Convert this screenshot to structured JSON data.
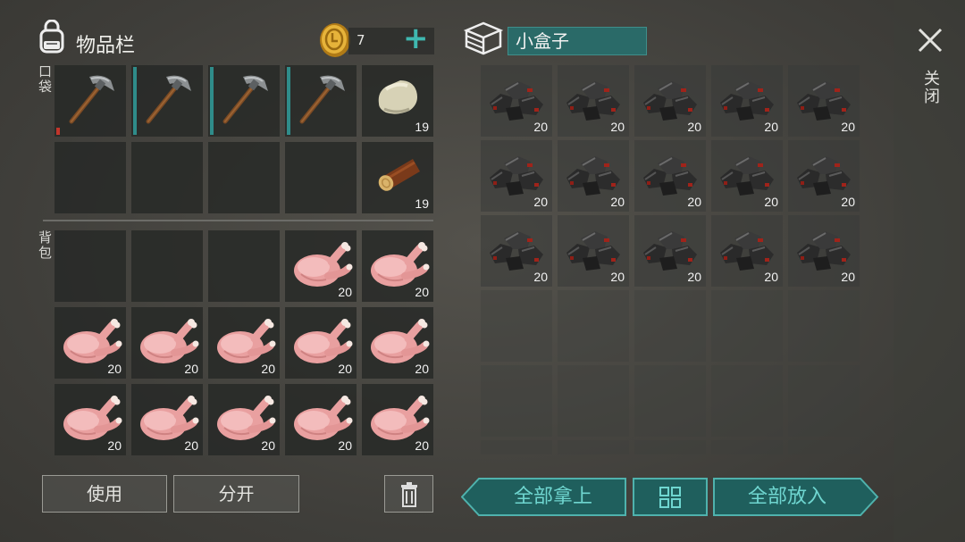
{
  "inventory": {
    "title": "物品栏",
    "pocket_label": "口袋",
    "backpack_label": "背包",
    "coins": "7",
    "add_symbol": "+",
    "pocket_slots": [
      {
        "item": "pickaxe",
        "count": "",
        "durability": "low"
      },
      {
        "item": "pickaxe",
        "count": "",
        "durability": "full"
      },
      {
        "item": "pickaxe",
        "count": "",
        "durability": "full"
      },
      {
        "item": "pickaxe",
        "count": "",
        "durability": "full"
      },
      {
        "item": "stone",
        "count": "19"
      },
      {
        "item": "",
        "count": ""
      },
      {
        "item": "",
        "count": ""
      },
      {
        "item": "",
        "count": ""
      },
      {
        "item": "",
        "count": ""
      },
      {
        "item": "log",
        "count": "19"
      }
    ],
    "backpack_slots": [
      {
        "item": "",
        "count": ""
      },
      {
        "item": "",
        "count": ""
      },
      {
        "item": "",
        "count": ""
      },
      {
        "item": "raw-chicken",
        "count": "20"
      },
      {
        "item": "raw-chicken",
        "count": "20"
      },
      {
        "item": "raw-chicken",
        "count": "20"
      },
      {
        "item": "raw-chicken",
        "count": "20"
      },
      {
        "item": "raw-chicken",
        "count": "20"
      },
      {
        "item": "raw-chicken",
        "count": "20"
      },
      {
        "item": "raw-chicken",
        "count": "20"
      },
      {
        "item": "raw-chicken",
        "count": "20"
      },
      {
        "item": "raw-chicken",
        "count": "20"
      },
      {
        "item": "raw-chicken",
        "count": "20"
      },
      {
        "item": "raw-chicken",
        "count": "20"
      },
      {
        "item": "raw-chicken",
        "count": "20"
      }
    ],
    "use_button": "使用",
    "split_button": "分开"
  },
  "box": {
    "name": "小盒子",
    "slots": [
      {
        "item": "coal",
        "count": "20"
      },
      {
        "item": "coal",
        "count": "20"
      },
      {
        "item": "coal",
        "count": "20"
      },
      {
        "item": "coal",
        "count": "20"
      },
      {
        "item": "coal",
        "count": "20"
      },
      {
        "item": "coal",
        "count": "20"
      },
      {
        "item": "coal",
        "count": "20"
      },
      {
        "item": "coal",
        "count": "20"
      },
      {
        "item": "coal",
        "count": "20"
      },
      {
        "item": "coal",
        "count": "20"
      },
      {
        "item": "coal",
        "count": "20"
      },
      {
        "item": "coal",
        "count": "20"
      },
      {
        "item": "coal",
        "count": "20"
      },
      {
        "item": "coal",
        "count": "20"
      },
      {
        "item": "coal",
        "count": "20"
      },
      {
        "item": "",
        "count": ""
      },
      {
        "item": "",
        "count": ""
      },
      {
        "item": "",
        "count": ""
      },
      {
        "item": "",
        "count": ""
      },
      {
        "item": "",
        "count": ""
      },
      {
        "item": "",
        "count": ""
      },
      {
        "item": "",
        "count": ""
      },
      {
        "item": "",
        "count": ""
      },
      {
        "item": "",
        "count": ""
      },
      {
        "item": "",
        "count": ""
      },
      {
        "item": "",
        "count": ""
      },
      {
        "item": "",
        "count": ""
      },
      {
        "item": "",
        "count": ""
      },
      {
        "item": "",
        "count": ""
      },
      {
        "item": "",
        "count": ""
      }
    ],
    "take_all_button": "全部拿上",
    "put_all_button": "全部放入"
  },
  "close_label": "关闭",
  "colors": {
    "accent": "#4fb2ad",
    "accent_dark": "#1f5f5d",
    "durability": "#2f8c8a",
    "durability_low": "#c2352b"
  }
}
